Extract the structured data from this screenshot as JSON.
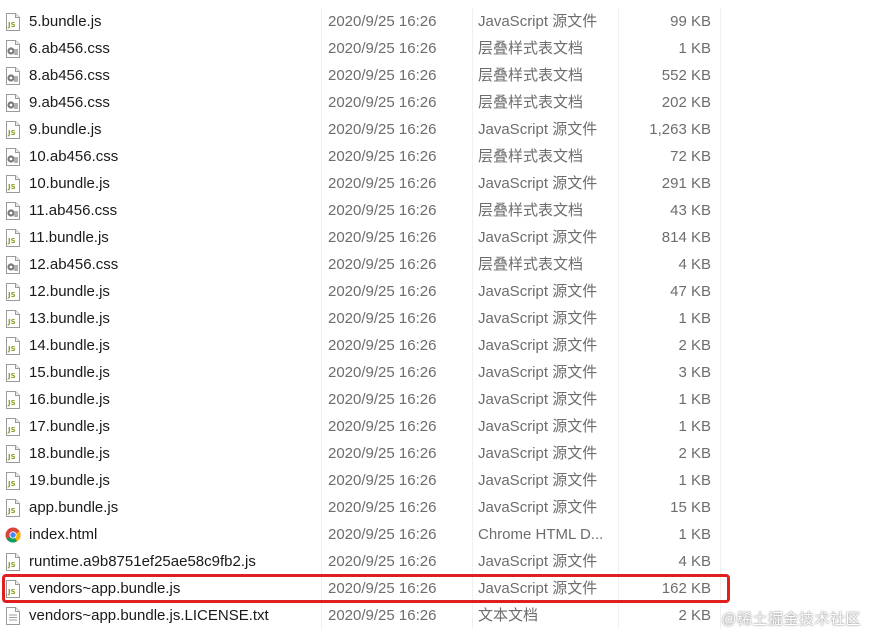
{
  "files": [
    {
      "name": "5.bundle.js",
      "date": "2020/9/25 16:26",
      "type": "JavaScript 源文件",
      "size": "99 KB",
      "icon": "js-file-icon"
    },
    {
      "name": "6.ab456.css",
      "date": "2020/9/25 16:26",
      "type": "层叠样式表文档",
      "size": "1 KB",
      "icon": "css-file-icon"
    },
    {
      "name": "8.ab456.css",
      "date": "2020/9/25 16:26",
      "type": "层叠样式表文档",
      "size": "552 KB",
      "icon": "css-file-icon"
    },
    {
      "name": "9.ab456.css",
      "date": "2020/9/25 16:26",
      "type": "层叠样式表文档",
      "size": "202 KB",
      "icon": "css-file-icon"
    },
    {
      "name": "9.bundle.js",
      "date": "2020/9/25 16:26",
      "type": "JavaScript 源文件",
      "size": "1,263 KB",
      "icon": "js-file-icon"
    },
    {
      "name": "10.ab456.css",
      "date": "2020/9/25 16:26",
      "type": "层叠样式表文档",
      "size": "72 KB",
      "icon": "css-file-icon"
    },
    {
      "name": "10.bundle.js",
      "date": "2020/9/25 16:26",
      "type": "JavaScript 源文件",
      "size": "291 KB",
      "icon": "js-file-icon"
    },
    {
      "name": "11.ab456.css",
      "date": "2020/9/25 16:26",
      "type": "层叠样式表文档",
      "size": "43 KB",
      "icon": "css-file-icon"
    },
    {
      "name": "11.bundle.js",
      "date": "2020/9/25 16:26",
      "type": "JavaScript 源文件",
      "size": "814 KB",
      "icon": "js-file-icon"
    },
    {
      "name": "12.ab456.css",
      "date": "2020/9/25 16:26",
      "type": "层叠样式表文档",
      "size": "4 KB",
      "icon": "css-file-icon"
    },
    {
      "name": "12.bundle.js",
      "date": "2020/9/25 16:26",
      "type": "JavaScript 源文件",
      "size": "47 KB",
      "icon": "js-file-icon"
    },
    {
      "name": "13.bundle.js",
      "date": "2020/9/25 16:26",
      "type": "JavaScript 源文件",
      "size": "1 KB",
      "icon": "js-file-icon"
    },
    {
      "name": "14.bundle.js",
      "date": "2020/9/25 16:26",
      "type": "JavaScript 源文件",
      "size": "2 KB",
      "icon": "js-file-icon"
    },
    {
      "name": "15.bundle.js",
      "date": "2020/9/25 16:26",
      "type": "JavaScript 源文件",
      "size": "3 KB",
      "icon": "js-file-icon"
    },
    {
      "name": "16.bundle.js",
      "date": "2020/9/25 16:26",
      "type": "JavaScript 源文件",
      "size": "1 KB",
      "icon": "js-file-icon"
    },
    {
      "name": "17.bundle.js",
      "date": "2020/9/25 16:26",
      "type": "JavaScript 源文件",
      "size": "1 KB",
      "icon": "js-file-icon"
    },
    {
      "name": "18.bundle.js",
      "date": "2020/9/25 16:26",
      "type": "JavaScript 源文件",
      "size": "2 KB",
      "icon": "js-file-icon"
    },
    {
      "name": "19.bundle.js",
      "date": "2020/9/25 16:26",
      "type": "JavaScript 源文件",
      "size": "1 KB",
      "icon": "js-file-icon"
    },
    {
      "name": "app.bundle.js",
      "date": "2020/9/25 16:26",
      "type": "JavaScript 源文件",
      "size": "15 KB",
      "icon": "js-file-icon"
    },
    {
      "name": "index.html",
      "date": "2020/9/25 16:26",
      "type": "Chrome HTML D...",
      "size": "1 KB",
      "icon": "chrome-html-icon"
    },
    {
      "name": "runtime.a9b8751ef25ae58c9fb2.js",
      "date": "2020/9/25 16:26",
      "type": "JavaScript 源文件",
      "size": "4 KB",
      "icon": "js-file-icon"
    },
    {
      "name": "vendors~app.bundle.js",
      "date": "2020/9/25 16:26",
      "type": "JavaScript 源文件",
      "size": "162 KB",
      "icon": "js-file-icon",
      "highlighted": true
    },
    {
      "name": "vendors~app.bundle.js.LICENSE.txt",
      "date": "2020/9/25 16:26",
      "type": "文本文档",
      "size": "2 KB",
      "icon": "text-file-icon"
    }
  ],
  "colors": {
    "highlight_border": "#e02020",
    "secondary_text": "#6d6d6d",
    "js_icon": "#8aa02a"
  },
  "watermark": "@稀土掘金技术社区"
}
